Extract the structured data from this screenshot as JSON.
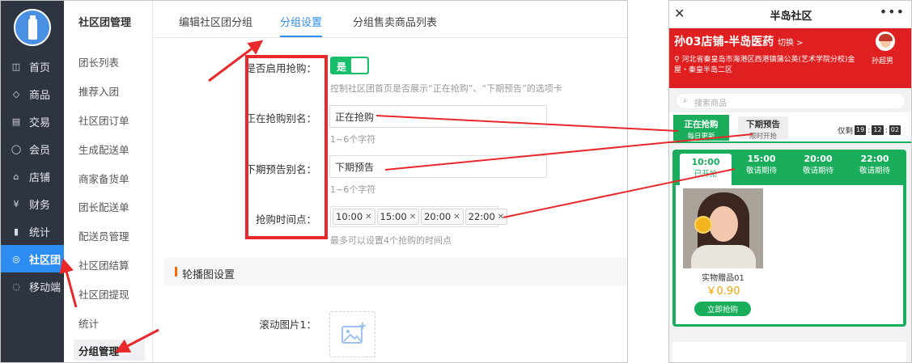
{
  "admin": {
    "nav": [
      {
        "icon": "chat-icon",
        "label": "首页"
      },
      {
        "icon": "tag-icon",
        "label": "商品"
      },
      {
        "icon": "document-icon",
        "label": "交易"
      },
      {
        "icon": "user-icon",
        "label": "会员"
      },
      {
        "icon": "store-icon",
        "label": "店铺"
      },
      {
        "icon": "yen-icon",
        "label": "财务"
      },
      {
        "icon": "bar-chart-icon",
        "label": "统计"
      },
      {
        "icon": "community-icon",
        "label": "社区团"
      },
      {
        "icon": "mobile-icon",
        "label": "移动端"
      }
    ],
    "subnav": {
      "title": "社区团管理",
      "items": [
        "团长列表",
        "推荐入团",
        "社区团订单",
        "生成配送单",
        "商家备货单",
        "团长配送单",
        "配送员管理",
        "社区团结算",
        "社区团提现",
        "统计",
        "分组管理"
      ]
    },
    "tabs": [
      "编辑社区团分组",
      "分组设置",
      "分组售卖商品列表"
    ],
    "form": {
      "enable_label": "是否启用抢购：",
      "enable_value": "是",
      "enable_hint": "控制社区团首页是否展示“正在抢购”、“下期预告”的选项卡",
      "current_label": "正在抢购别名：",
      "current_value": "正在抢购",
      "current_hint": "1~6个字符",
      "next_label": "下期预告别名：",
      "next_value": "下期预告",
      "next_hint": "1~6个字符",
      "time_label": "抢购时间点：",
      "times": [
        "10:00",
        "15:00",
        "20:00",
        "22:00"
      ],
      "time_hint": "最多可以设置4个抢购的时间点",
      "section_title": "轮播图设置",
      "banner_label": "滚动图片1："
    }
  },
  "phone": {
    "title": "半岛社区",
    "shop_name": "孙03店铺-半岛医药",
    "switch_label": "切换 >",
    "address": "河北省秦皇岛市海港区西港镇蒲公英(艺术学院分校)金屋・秦皇半岛二区",
    "user_name": "孙超男",
    "search_placeholder": "搜索商品",
    "tab_current": {
      "title": "正在抢购",
      "sub": "每日更新"
    },
    "tab_next": {
      "title": "下期预告",
      "sub": "限时开抢"
    },
    "countdown_prefix": "仅剩",
    "countdown": [
      "19",
      "12",
      "02"
    ],
    "slots": [
      {
        "time": "10:00",
        "status": "已开抢"
      },
      {
        "time": "15:00",
        "status": "敬请期待"
      },
      {
        "time": "20:00",
        "status": "敬请期待"
      },
      {
        "time": "22:00",
        "status": "敬请期待"
      }
    ],
    "product": {
      "name": "实物赠品01",
      "price": "￥0.90",
      "button": "立即抢购"
    }
  },
  "colors": {
    "admin_nav": "#2f3441",
    "admin_accent": "#2d8cf0",
    "toggle_green": "#19be6b",
    "phone_red": "#e02020",
    "phone_green": "#1aad5b",
    "annotation_red": "#e8282b",
    "price_orange": "#f0a500"
  }
}
